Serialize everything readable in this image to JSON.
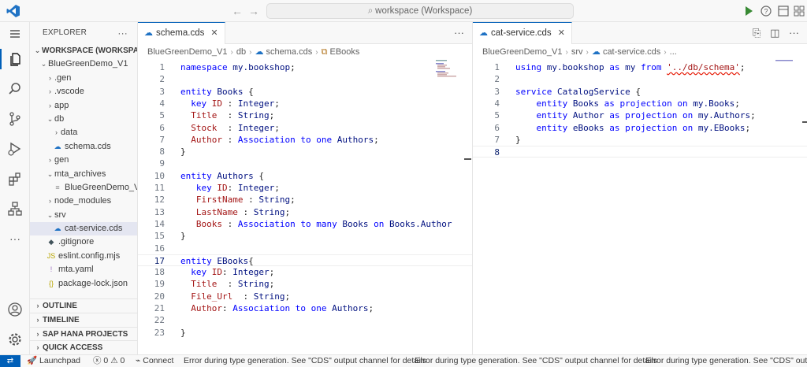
{
  "titlebar": {
    "search_text": "workspace (Workspace)",
    "back_icon": "arrow-left-icon",
    "forward_icon": "arrow-right-icon"
  },
  "activitybar": {
    "items": [
      "menu-icon",
      "explorer-icon",
      "search-icon",
      "source-control-icon",
      "run-debug-icon",
      "extensions-icon",
      "sap-hana-icon",
      "more-icon"
    ],
    "bottom": [
      "account-icon",
      "settings-icon"
    ]
  },
  "explorer": {
    "header": "EXPLORER",
    "header_more": "···",
    "workspace_label": "WORKSPACE (WORKSPACE)",
    "project": "BlueGreenDemo_V1",
    "items": [
      {
        "label": ".gen",
        "kind": "folder"
      },
      {
        "label": ".vscode",
        "kind": "folder"
      },
      {
        "label": "app",
        "kind": "folder"
      },
      {
        "label": "db",
        "kind": "folder-open"
      },
      {
        "label": "data",
        "kind": "folder"
      },
      {
        "label": "schema.cds",
        "kind": "cds"
      },
      {
        "label": "gen",
        "kind": "folder"
      },
      {
        "label": "mta_archives",
        "kind": "folder-open"
      },
      {
        "label": "BlueGreenDemo_V...",
        "kind": "file"
      },
      {
        "label": "node_modules",
        "kind": "folder"
      },
      {
        "label": "srv",
        "kind": "folder-open"
      },
      {
        "label": "cat-service.cds",
        "kind": "cds"
      },
      {
        "label": ".gitignore",
        "kind": "git"
      },
      {
        "label": "eslint.config.mjs",
        "kind": "js"
      },
      {
        "label": "mta.yaml",
        "kind": "yaml"
      },
      {
        "label": "package-lock.json",
        "kind": "json"
      }
    ],
    "sections": [
      "OUTLINE",
      "TIMELINE",
      "SAP HANA PROJECTS",
      "QUICK ACCESS"
    ]
  },
  "left_editor": {
    "tab_label": "schema.cds",
    "breadcrumb": [
      "BlueGreenDemo_V1",
      "db",
      "schema.cds",
      "EBooks"
    ],
    "lines": [
      "namespace my.bookshop;",
      "",
      "entity Books {",
      "  key ID : Integer;",
      "  Title  : String;",
      "  Stock  : Integer;",
      "  Author : Association to one Authors;",
      "}",
      "",
      "entity Authors {",
      "   key ID: Integer;",
      "   FirstName : String;",
      "   LastName : String;",
      "   Books : Association to many Books on Books.Author",
      "}",
      "",
      "entity EBooks{",
      "  key ID: Integer;",
      "  Title  : String;",
      "  File_Url  : String;",
      "  Author: Association to one Authors;",
      "",
      "}"
    ],
    "current_line": 17
  },
  "right_editor": {
    "tab_label": "cat-service.cds",
    "breadcrumb": [
      "BlueGreenDemo_V1",
      "srv",
      "cat-service.cds",
      "..."
    ],
    "lines": [
      "using my.bookshop as my from '../db/schema';",
      "",
      "service CatalogService {",
      "    entity Books as projection on my.Books;",
      "    entity Author as projection on my.Authors;",
      "    entity eBooks as projection on my.EBooks;",
      "}",
      ""
    ],
    "current_line": 8
  },
  "statusbar": {
    "launchpad": "Launchpad",
    "errors": "0",
    "warnings": "0",
    "connect": "Connect",
    "message": "Error during type generation. See \"CDS\" output channel for details",
    "message_truncated": "Error during type generation. See \"CDS\" output ch"
  },
  "colors": {
    "accent": "#005fb8",
    "keyword": "#0000ff",
    "string": "#a31515",
    "run": "#388a34"
  }
}
